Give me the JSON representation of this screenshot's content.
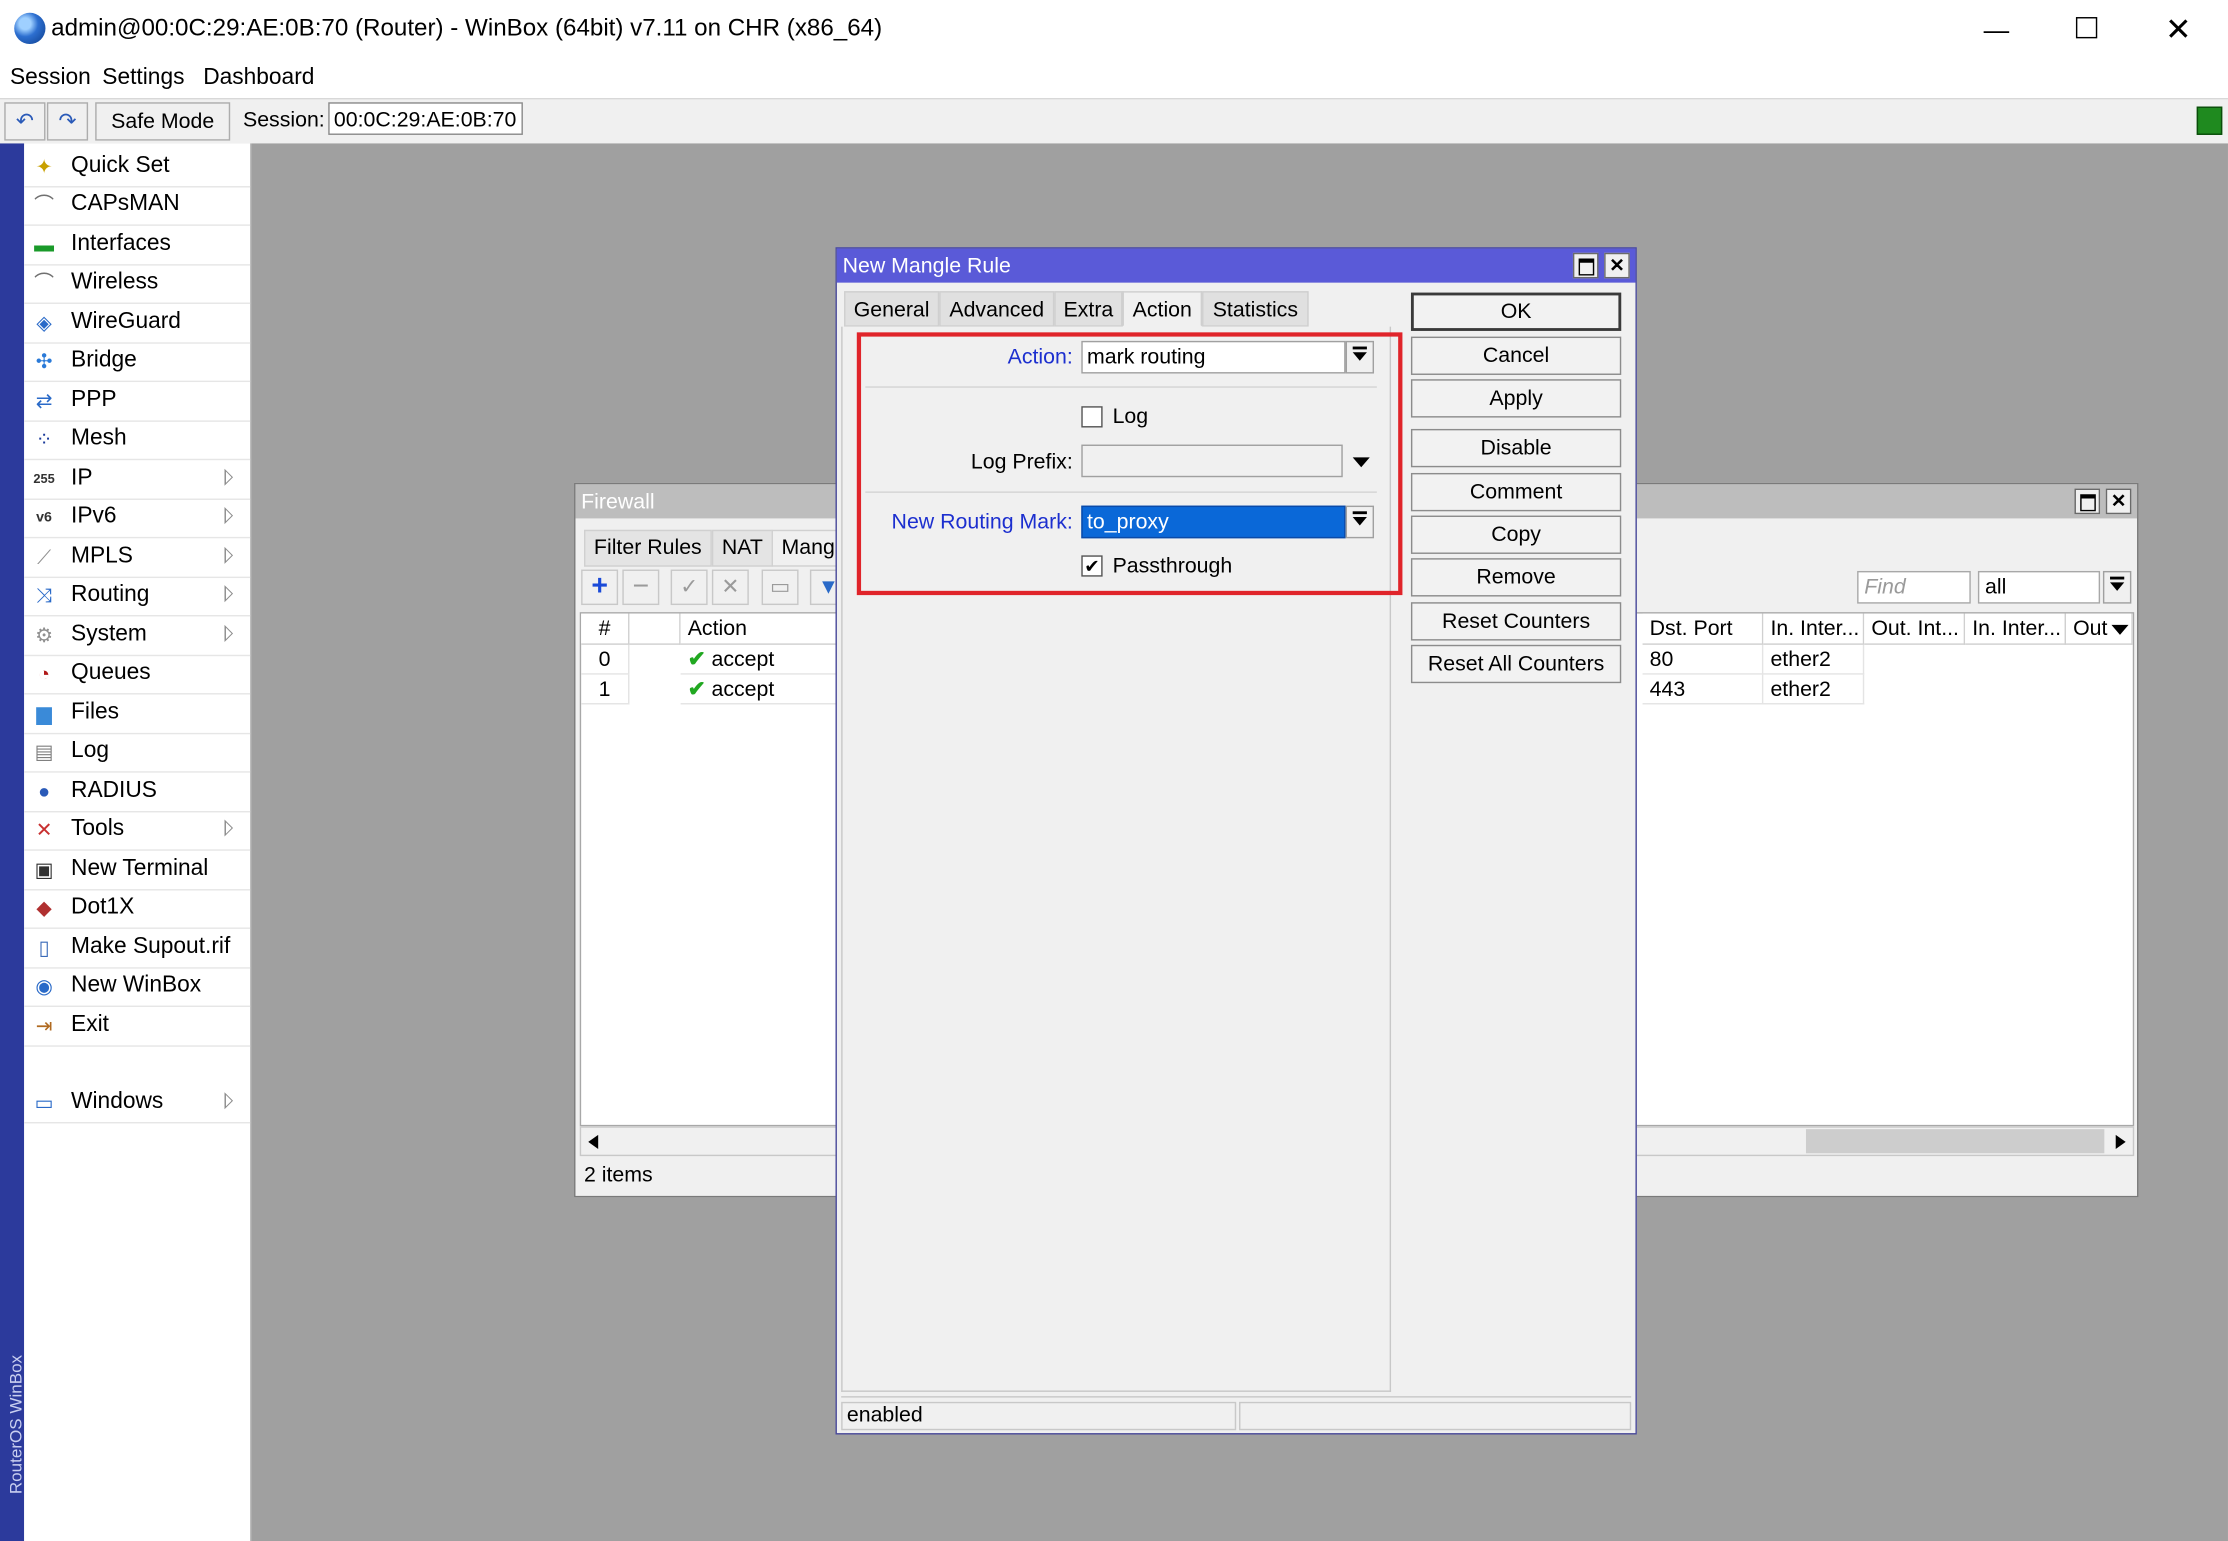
{
  "window": {
    "title": "admin@00:0C:29:AE:0B:70 (Router) - WinBox (64bit) v7.11 on CHR (x86_64)",
    "minimize": "—",
    "close": "✕"
  },
  "menubar": [
    "Session",
    "Settings",
    "Dashboard"
  ],
  "toolbar": {
    "undo": "↶",
    "redo": "↷",
    "safe_mode": "Safe Mode",
    "session_label": "Session:",
    "session_value": "00:0C:29:AE:0B:70"
  },
  "strip_text": "RouterOS WinBox",
  "sidebar": [
    {
      "label": "Quick Set",
      "icon": "wand-icon",
      "glyph": "✦",
      "color": "#c8a000",
      "submenu": false
    },
    {
      "label": "CAPsMAN",
      "icon": "antenna-icon",
      "glyph": "⌒",
      "color": "#707070",
      "submenu": false
    },
    {
      "label": "Interfaces",
      "icon": "interfaces-icon",
      "glyph": "▬",
      "color": "#1a9a2a",
      "submenu": false
    },
    {
      "label": "Wireless",
      "icon": "wireless-icon",
      "glyph": "⌒",
      "color": "#707070",
      "submenu": false
    },
    {
      "label": "WireGuard",
      "icon": "wireguard-icon",
      "glyph": "◈",
      "color": "#2a6ac8",
      "submenu": false
    },
    {
      "label": "Bridge",
      "icon": "bridge-icon",
      "glyph": "✣",
      "color": "#2a7ad8",
      "submenu": false
    },
    {
      "label": "PPP",
      "icon": "ppp-icon",
      "glyph": "⇄",
      "color": "#2a6ac8",
      "submenu": false
    },
    {
      "label": "Mesh",
      "icon": "mesh-icon",
      "glyph": "⁘",
      "color": "#1a3a9a",
      "submenu": false
    },
    {
      "label": "IP",
      "icon": "ip-icon",
      "glyph": "255",
      "color": "#333333",
      "submenu": true
    },
    {
      "label": "IPv6",
      "icon": "ipv6-icon",
      "glyph": "v6",
      "color": "#333333",
      "submenu": true
    },
    {
      "label": "MPLS",
      "icon": "mpls-icon",
      "glyph": "⟋",
      "color": "#909090",
      "submenu": true
    },
    {
      "label": "Routing",
      "icon": "routing-icon",
      "glyph": "⤨",
      "color": "#2a6ac8",
      "submenu": true
    },
    {
      "label": "System",
      "icon": "gear-icon",
      "glyph": "⚙",
      "color": "#909090",
      "submenu": true
    },
    {
      "label": "Queues",
      "icon": "queues-icon",
      "glyph": "◔",
      "color": "#b01818",
      "submenu": false
    },
    {
      "label": "Files",
      "icon": "folder-icon",
      "glyph": "▆",
      "color": "#3a8ad8",
      "submenu": false
    },
    {
      "label": "Log",
      "icon": "log-icon",
      "glyph": "▤",
      "color": "#808080",
      "submenu": false
    },
    {
      "label": "RADIUS",
      "icon": "radius-icon",
      "glyph": "●",
      "color": "#2a5ab8",
      "submenu": false
    },
    {
      "label": "Tools",
      "icon": "tools-icon",
      "glyph": "✕",
      "color": "#c83030",
      "submenu": true
    },
    {
      "label": "New Terminal",
      "icon": "terminal-icon",
      "glyph": "▣",
      "color": "#303030",
      "submenu": false
    },
    {
      "label": "Dot1X",
      "icon": "dot1x-icon",
      "glyph": "◆",
      "color": "#b03030",
      "submenu": false
    },
    {
      "label": "Make Supout.rif",
      "icon": "supout-icon",
      "glyph": "▯",
      "color": "#3a6ab8",
      "submenu": false
    },
    {
      "label": "New WinBox",
      "icon": "winbox-icon",
      "glyph": "◉",
      "color": "#2a6ac8",
      "submenu": false
    },
    {
      "label": "Exit",
      "icon": "exit-icon",
      "glyph": "⇥",
      "color": "#b06a20",
      "submenu": false
    },
    {
      "label": "Windows",
      "icon": "windows-icon",
      "glyph": "▭",
      "color": "#2a6ac8",
      "submenu": true
    }
  ],
  "firewall": {
    "title": "Firewall",
    "tabs": [
      "Filter Rules",
      "NAT",
      "Mang"
    ],
    "find_placeholder": "Find",
    "filter_value": "all",
    "columns_left": [
      "#",
      "",
      "Action"
    ],
    "columns_right": [
      "Dst. Port",
      "In. Inter...",
      "Out. Int...",
      "In. Inter...",
      "Out"
    ],
    "rows": [
      {
        "num": "0",
        "action": "accept",
        "dst_port": "80",
        "in_iface": "ether2"
      },
      {
        "num": "1",
        "action": "accept",
        "dst_port": "443",
        "in_iface": "ether2"
      }
    ],
    "status": "2 items"
  },
  "dialog": {
    "title": "New Mangle Rule",
    "tabs": [
      "General",
      "Advanced",
      "Extra",
      "Action",
      "Statistics"
    ],
    "active_tab": "Action",
    "fields": {
      "action_label": "Action:",
      "action_value": "mark routing",
      "log_label": "Log",
      "log_prefix_label": "Log Prefix:",
      "log_prefix_value": "",
      "routing_mark_label": "New Routing Mark:",
      "routing_mark_value": "to_proxy",
      "passthrough_label": "Passthrough",
      "passthrough_checked": "✔"
    },
    "buttons": [
      "OK",
      "Cancel",
      "Apply",
      "Disable",
      "Comment",
      "Copy",
      "Remove",
      "Reset Counters",
      "Reset All Counters"
    ],
    "status": "enabled"
  },
  "colors": {
    "dialog_title": "#5a5ad8",
    "highlight_box": "#e0242a",
    "label_blue": "#1c2fcf",
    "selection": "#0a68d8",
    "accept_check": "#21a821"
  }
}
